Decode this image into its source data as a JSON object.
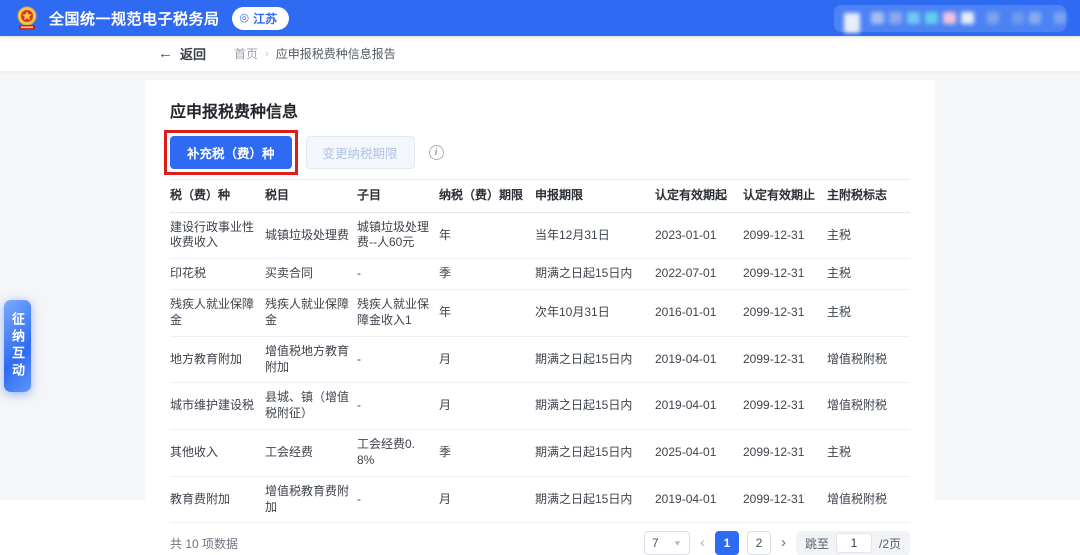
{
  "colors": {
    "header_blue": "#2e6bf2",
    "primary_blue": "#2e6bf2",
    "annotation_red": "#de1c1c",
    "page_bg": "#f5f6f8"
  },
  "header": {
    "app_title": "全国统一规范电子税务局",
    "location_badge": "江苏"
  },
  "breadcrumb": {
    "back_label": "返回",
    "home": "首页",
    "separator": "›",
    "current": "应申报税费种信息报告"
  },
  "side_tab": {
    "label": "征纳互动"
  },
  "page": {
    "title": "应申报税费种信息",
    "supplement_button": "补充税（费）种",
    "change_period_button": "变更纳税期限"
  },
  "table": {
    "columns": [
      "税（费）种",
      "税目",
      "子目",
      "纳税（费）期限",
      "申报期限",
      "认定有效期起",
      "认定有效期止",
      "主附税标志"
    ],
    "rows": [
      [
        "建设行政事业性收费收入",
        "城镇垃圾处理费",
        "城镇垃圾处理费--人60元",
        "年",
        "当年12月31日",
        "2023-01-01",
        "2099-12-31",
        "主税"
      ],
      [
        "印花税",
        "买卖合同",
        "-",
        "季",
        "期满之日起15日内",
        "2022-07-01",
        "2099-12-31",
        "主税"
      ],
      [
        "残疾人就业保障金",
        "残疾人就业保障金",
        "残疾人就业保障金收入1",
        "年",
        "次年10月31日",
        "2016-01-01",
        "2099-12-31",
        "主税"
      ],
      [
        "地方教育附加",
        "增值税地方教育附加",
        "-",
        "月",
        "期满之日起15日内",
        "2019-04-01",
        "2099-12-31",
        "增值税附税"
      ],
      [
        "城市维护建设税",
        "县城、镇（增值税附征）",
        "-",
        "月",
        "期满之日起15日内",
        "2019-04-01",
        "2099-12-31",
        "增值税附税"
      ],
      [
        "其他收入",
        "工会经费",
        "工会经费0.8%",
        "季",
        "期满之日起15日内",
        "2025-04-01",
        "2099-12-31",
        "主税"
      ],
      [
        "教育费附加",
        "增值税教育费附加",
        "-",
        "月",
        "期满之日起15日内",
        "2019-04-01",
        "2099-12-31",
        "增值税附税"
      ]
    ]
  },
  "pagination": {
    "total_text": "共 10 项数据",
    "page_size": "7",
    "pages": [
      "1",
      "2"
    ],
    "active_page": "1",
    "jump_label": "跳至",
    "jump_value": "1",
    "total_pages_label": "/2页"
  }
}
